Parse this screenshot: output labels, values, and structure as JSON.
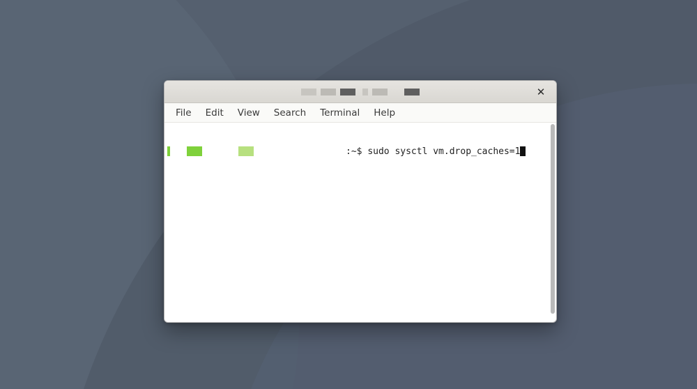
{
  "titlebar": {
    "close_glyph": "✕"
  },
  "menubar": {
    "items": [
      "File",
      "Edit",
      "View",
      "Search",
      "Terminal",
      "Help"
    ]
  },
  "terminal": {
    "prompt_suffix": ":~$ ",
    "command": "sudo sysctl vm.drop_caches=1"
  }
}
